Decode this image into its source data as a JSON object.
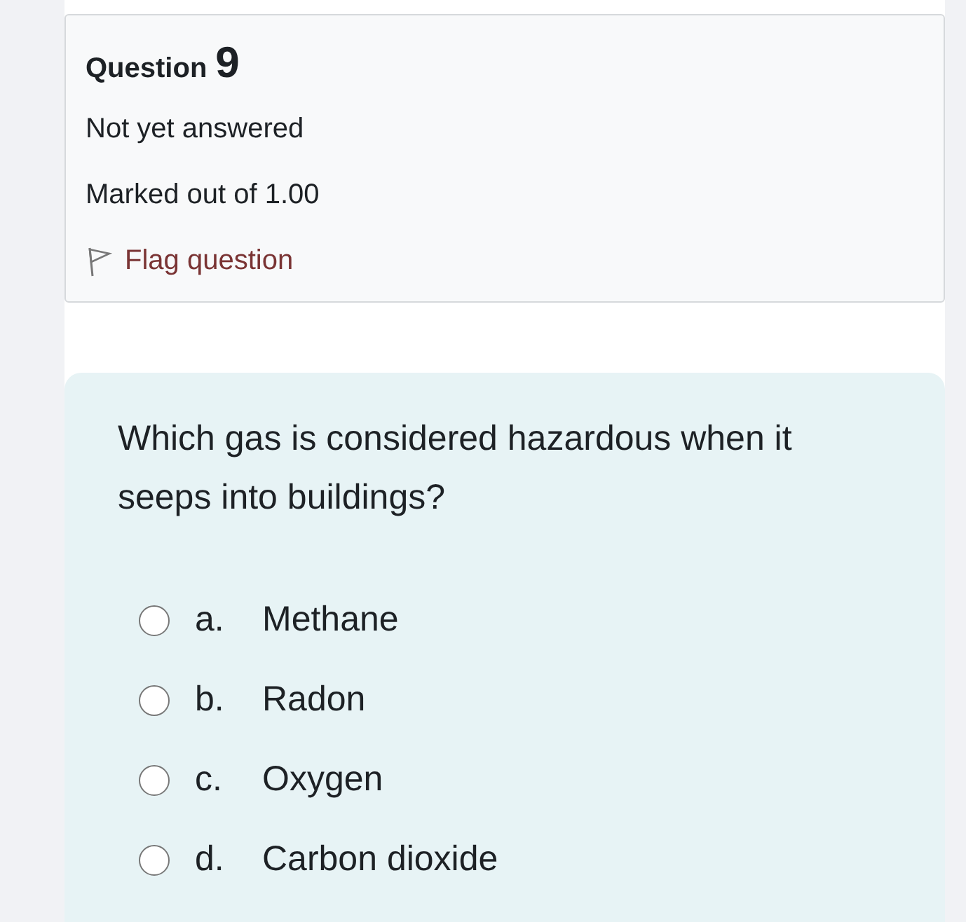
{
  "question_info": {
    "label": "Question",
    "number": "9",
    "state": "Not yet answered",
    "grade": "Marked out of 1.00",
    "flag": {
      "label": "Flag question",
      "flagged": false
    }
  },
  "question": {
    "text": "Which gas is considered hazardous when it seeps into buildings?",
    "options": [
      {
        "letter": "a.",
        "text": "Methane",
        "selected": false
      },
      {
        "letter": "b.",
        "text": "Radon",
        "selected": false
      },
      {
        "letter": "c.",
        "text": "Oxygen",
        "selected": false
      },
      {
        "letter": "d.",
        "text": "Carbon dioxide",
        "selected": false
      }
    ]
  }
}
